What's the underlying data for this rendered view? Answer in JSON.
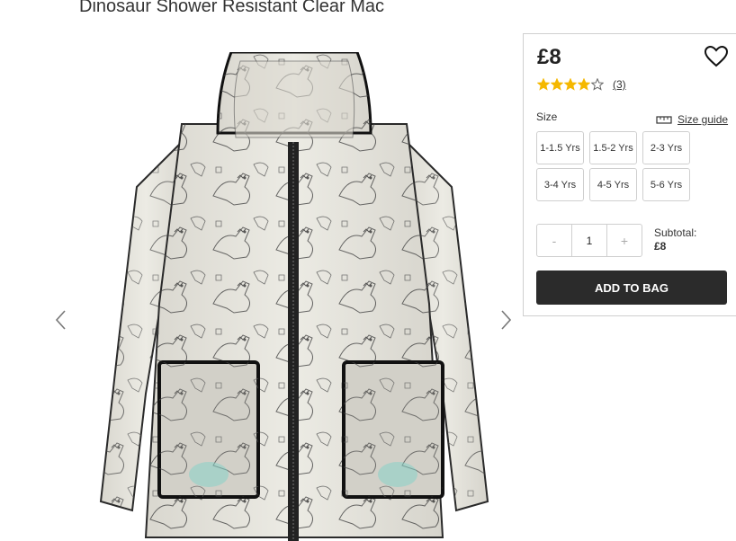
{
  "product": {
    "title": "Dinosaur Shower Resistant Clear Mac",
    "price": "£8",
    "rating": 4,
    "rating_max": 5,
    "review_count": "(3)"
  },
  "gallery": {
    "prev_icon": "chevron-left-icon",
    "next_icon": "chevron-right-icon"
  },
  "sizes": {
    "label": "Size",
    "guide_label": "Size guide",
    "options": [
      "1-1.5 Yrs",
      "1.5-2 Yrs",
      "2-3 Yrs",
      "3-4 Yrs",
      "4-5 Yrs",
      "5-6 Yrs"
    ]
  },
  "quantity": {
    "minus": "-",
    "value": "1",
    "plus": "+"
  },
  "subtotal": {
    "label": "Subtotal:",
    "value": "£8"
  },
  "actions": {
    "add_to_bag": "ADD TO BAG"
  },
  "colors": {
    "star": "#f5b800",
    "button_bg": "#2b2b2b",
    "border": "#cfcfcf"
  }
}
